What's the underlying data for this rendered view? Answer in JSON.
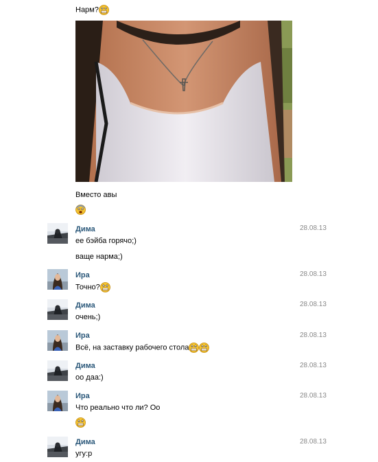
{
  "messages": {
    "m0_text": "Нарм?",
    "m0_emoji": "grinning-emoji",
    "m1_caption": "Вместо авы",
    "m1_emoji": "scared-emoji",
    "dima1": {
      "name": "Дима",
      "date": "28.08.13",
      "line1": "ее бэйба горячо;)",
      "line2": "ваще нарма;)"
    },
    "ira1": {
      "name": "Ира",
      "date": "28.08.13",
      "line1": "Точно?"
    },
    "dima2": {
      "name": "Дима",
      "date": "28.08.13",
      "line1": "очень;)"
    },
    "ira2": {
      "name": "Ира",
      "date": "28.08.13",
      "line1": "Всё, на заставку рабочего стола"
    },
    "dima3": {
      "name": "Дима",
      "date": "28.08.13",
      "line1": "оо даа:)"
    },
    "ira3": {
      "name": "Ира",
      "date": "28.08.13",
      "line1": "Что реально что ли? Оо"
    },
    "dima4": {
      "name": "Дима",
      "date": "28.08.13",
      "line1": "угу:р"
    }
  },
  "colors": {
    "name": "#2b587a",
    "date": "#888888",
    "emoji_face": "#f5c431"
  }
}
